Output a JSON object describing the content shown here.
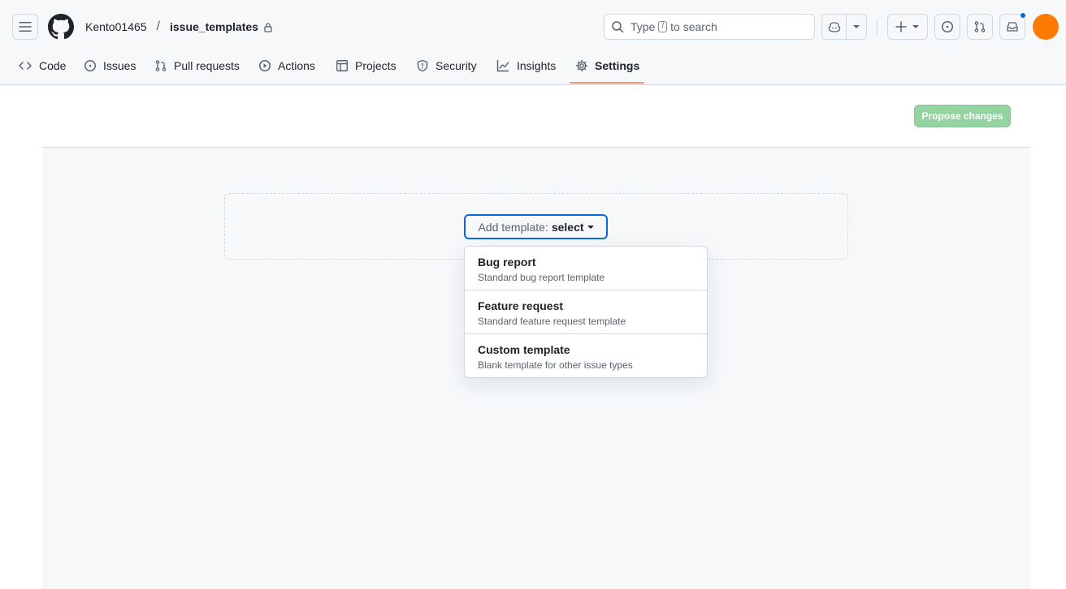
{
  "header": {
    "owner": "Kento01465",
    "separator": "/",
    "repo": "issue_templates",
    "search": {
      "prefix": "Type",
      "key": "/",
      "suffix": "to search"
    },
    "avatar_color": "#ff7a00",
    "notification_color": "#0969da"
  },
  "nav": {
    "tabs": [
      {
        "label": "Code",
        "icon": "code-icon"
      },
      {
        "label": "Issues",
        "icon": "issue-opened-icon"
      },
      {
        "label": "Pull requests",
        "icon": "git-pull-request-icon"
      },
      {
        "label": "Actions",
        "icon": "play-icon"
      },
      {
        "label": "Projects",
        "icon": "table-icon"
      },
      {
        "label": "Security",
        "icon": "shield-icon"
      },
      {
        "label": "Insights",
        "icon": "graph-icon"
      },
      {
        "label": "Settings",
        "icon": "gear-icon",
        "selected": true
      }
    ],
    "selected_color": "#fd8c73"
  },
  "main": {
    "propose_button": "Propose changes",
    "propose_color": "#94d3a2",
    "add_template": {
      "prefix": "Add template:",
      "value": "select"
    },
    "dropdown": [
      {
        "title": "Bug report",
        "description": "Standard bug report template"
      },
      {
        "title": "Feature request",
        "description": "Standard feature request template"
      },
      {
        "title": "Custom template",
        "description": "Blank template for other issue types"
      }
    ]
  }
}
